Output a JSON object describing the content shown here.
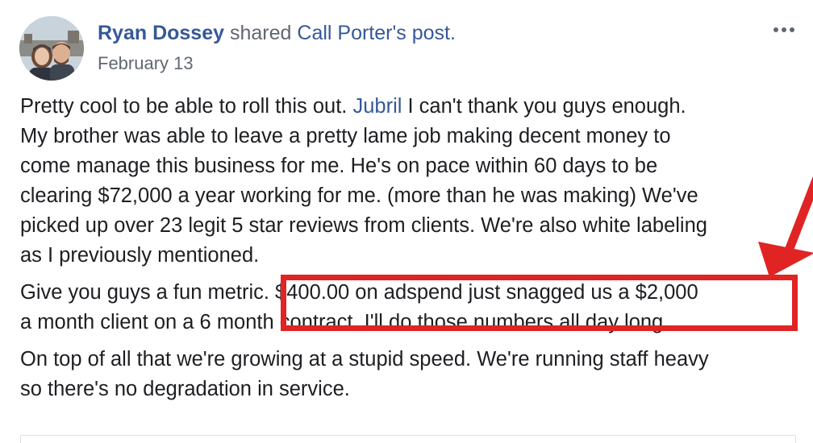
{
  "post": {
    "author": "Ryan Dossey",
    "shared_text": "shared",
    "shared_link": "Call Porter's post.",
    "date": "February 13",
    "more_icon": "ellipsis-icon",
    "body": {
      "p1": {
        "l1_before": "Pretty cool to be able to roll this out. ",
        "l1_mention": "Jubril",
        "l1_after": " I can't thank you guys enough.",
        "l2": "My brother was able to leave a pretty lame job making decent money to",
        "l3": "come manage this business for me. He's on pace within 60 days to be",
        "l4": "clearing $72,000 a year working for me. (more than he was making) We've",
        "l5": "picked up over 23 legit 5 star reviews from clients. We're also white labeling",
        "l6": "as I previously mentioned."
      },
      "p2": {
        "l1": "Give you guys a fun metric. $400.00 on adspend just snagged us a $2,000",
        "l2": "a month client on a 6 month contract. I'll do those numbers all day long."
      },
      "p3": {
        "l1": "On top of all that we're growing at a stupid speed. We're running staff heavy",
        "l2": "so there's no degradation in service."
      }
    }
  },
  "colors": {
    "link": "#365899",
    "meta": "#616770",
    "text": "#1c1e21",
    "annotation": "#e02424"
  }
}
